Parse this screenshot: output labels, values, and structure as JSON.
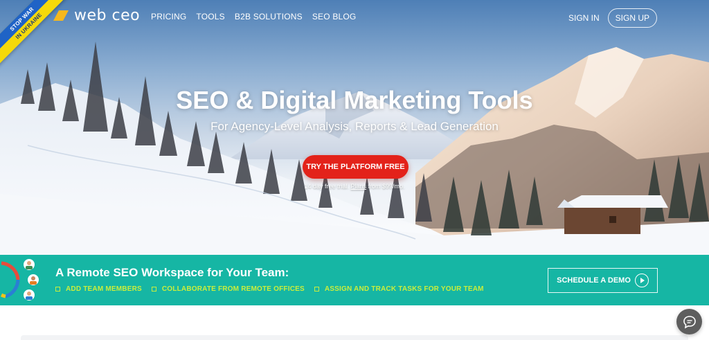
{
  "ribbon": {
    "line1": "STOP WAR",
    "line2": "IN UKRAINE"
  },
  "nav": {
    "logo_text": "web ceo",
    "links": [
      "PRICING",
      "TOOLS",
      "B2B SOLUTIONS",
      "SEO BLOG"
    ],
    "sign_in": "SIGN IN",
    "sign_up": "SIGN UP"
  },
  "hero": {
    "title": "SEO & Digital Marketing Tools",
    "subtitle": "For Agency-Level Analysis, Reports & Lead Generation",
    "cta": "TRY THE PLATFORM FREE",
    "trial_prefix": "14 day free trial.",
    "trial_link": "Plans",
    "trial_suffix": "from $99/mo."
  },
  "banner": {
    "title": "A Remote SEO Workspace for Your Team:",
    "features": [
      "ADD TEAM MEMBERS",
      "COLLABORATE FROM REMOTE OFFICES",
      "ASSIGN AND TRACK TASKS FOR YOUR TEAM"
    ],
    "demo_button": "SCHEDULE A DEMO"
  },
  "colors": {
    "accent_red": "#e3221a",
    "banner_teal": "#16b6a4",
    "feature_lime": "#c9ee3c",
    "logo_yellow": "#f6b81c"
  }
}
